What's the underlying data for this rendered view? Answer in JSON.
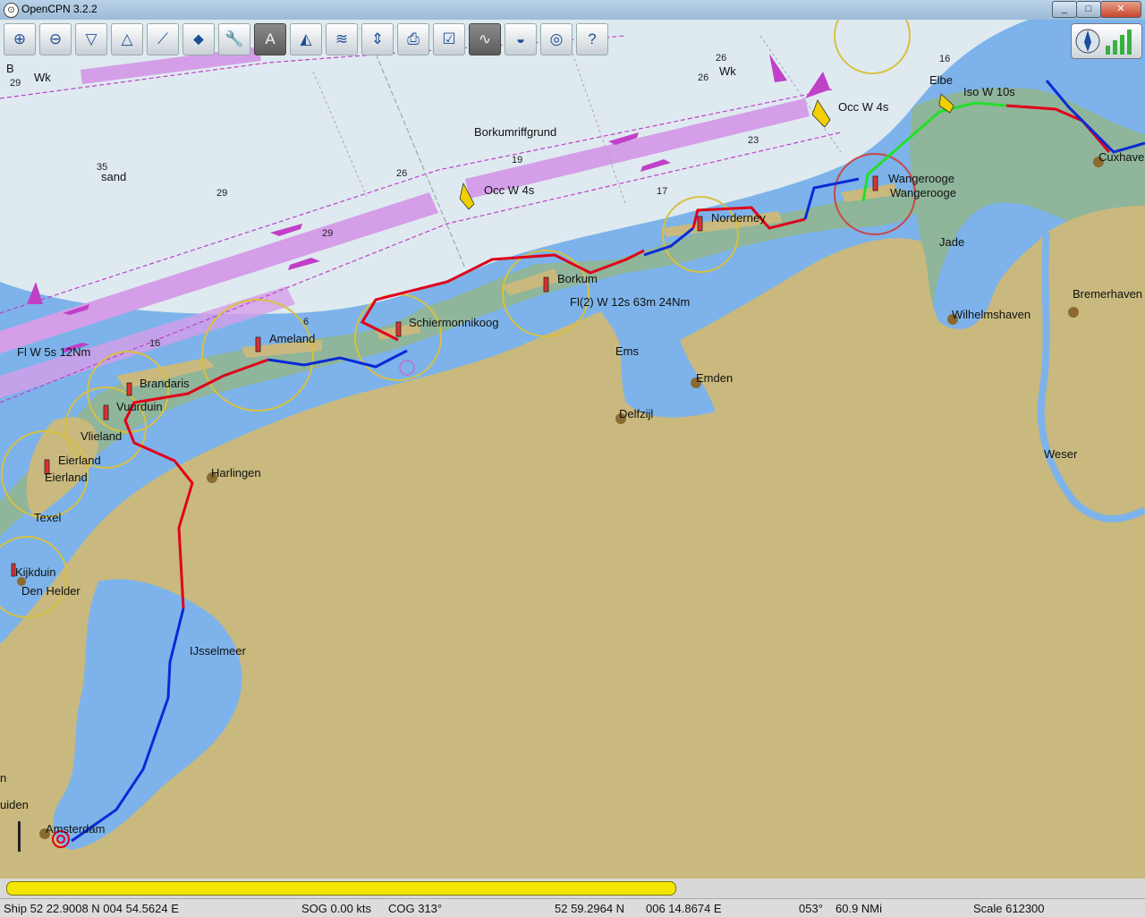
{
  "window": {
    "title": "OpenCPN 3.2.2",
    "min": "_",
    "max": "□",
    "close": "✕"
  },
  "toolbar": {
    "buttons": [
      {
        "name": "zoom-in-button",
        "icon": "zoom-in-icon",
        "glyph": "⊕"
      },
      {
        "name": "zoom-out-button",
        "icon": "zoom-out-icon",
        "glyph": "⊖"
      },
      {
        "name": "scale-in-button",
        "icon": "scale-in-icon",
        "glyph": "▽"
      },
      {
        "name": "scale-out-button",
        "icon": "scale-out-icon",
        "glyph": "△"
      },
      {
        "name": "create-route-button",
        "icon": "route-icon",
        "glyph": "⟋"
      },
      {
        "name": "auto-follow-button",
        "icon": "ship-icon",
        "glyph": "⬥"
      },
      {
        "name": "options-button",
        "icon": "wrench-icon",
        "glyph": "🔧"
      },
      {
        "name": "text-button",
        "icon": "text-icon",
        "glyph": "A"
      },
      {
        "name": "current-button",
        "icon": "current-icon",
        "glyph": "◭"
      },
      {
        "name": "tide-button",
        "icon": "tide-icon",
        "glyph": "≋"
      },
      {
        "name": "quilt-button",
        "icon": "quilt-icon",
        "glyph": "⇕"
      },
      {
        "name": "print-button",
        "icon": "printer-icon",
        "glyph": "⎙"
      },
      {
        "name": "route-manager-button",
        "icon": "route-manager-icon",
        "glyph": "☑"
      },
      {
        "name": "track-button",
        "icon": "track-icon",
        "glyph": "∿"
      },
      {
        "name": "color-scheme-button",
        "icon": "sun-icon",
        "glyph": "◒"
      },
      {
        "name": "mob-button",
        "icon": "lifebuoy-icon",
        "glyph": "◎"
      },
      {
        "name": "help-button",
        "icon": "help-icon",
        "glyph": "?"
      }
    ]
  },
  "chart": {
    "places": [
      {
        "id": "wangerooge",
        "text": "Wangerooge"
      },
      {
        "id": "wangerooge2",
        "text": "Wangerooge"
      },
      {
        "id": "norderney",
        "text": "Norderney"
      },
      {
        "id": "borkum",
        "text": "Borkum"
      },
      {
        "id": "schiermonnikoog",
        "text": "Schiermonnikoog"
      },
      {
        "id": "ameland",
        "text": "Ameland"
      },
      {
        "id": "brandaris",
        "text": "Brandaris"
      },
      {
        "id": "vuurduin",
        "text": "Vuurduin"
      },
      {
        "id": "vlieland",
        "text": "Vlieland"
      },
      {
        "id": "eierland",
        "text": "Eierland"
      },
      {
        "id": "eierland2",
        "text": "Eierland"
      },
      {
        "id": "texel",
        "text": "Texel"
      },
      {
        "id": "kijkduin",
        "text": "Kijkduin"
      },
      {
        "id": "den-helder",
        "text": "Den Helder"
      },
      {
        "id": "harlingen",
        "text": "Harlingen"
      },
      {
        "id": "ijsselmeer",
        "text": "IJsselmeer"
      },
      {
        "id": "amsterdam",
        "text": "Amsterdam"
      },
      {
        "id": "ijmuiden",
        "text": "uiden"
      },
      {
        "id": "ems",
        "text": "Ems"
      },
      {
        "id": "emden",
        "text": "Emden"
      },
      {
        "id": "delfzijl",
        "text": "Delfzijl"
      },
      {
        "id": "jade",
        "text": "Jade"
      },
      {
        "id": "wilhelmshaven",
        "text": "Wilhelmshaven"
      },
      {
        "id": "bremerhaven",
        "text": "Bremerhaven"
      },
      {
        "id": "weser",
        "text": "Weser"
      },
      {
        "id": "cuxhaven",
        "text": "Cuxhaven"
      },
      {
        "id": "elbe",
        "text": "Elbe"
      },
      {
        "id": "borkumriffgrund",
        "text": "Borkumriffgrund"
      },
      {
        "id": "sand",
        "text": "sand"
      },
      {
        "id": "wk1",
        "text": "Wk"
      },
      {
        "id": "wk2",
        "text": "Wk"
      },
      {
        "id": "b",
        "text": "B"
      },
      {
        "id": "n",
        "text": "n"
      }
    ],
    "lights": [
      {
        "id": "occ1",
        "text": "Occ W 4s"
      },
      {
        "id": "occ2",
        "text": "Occ W 4s"
      },
      {
        "id": "iso",
        "text": "Iso W 10s"
      },
      {
        "id": "fl2",
        "text": "Fl(2) W 12s 63m 24Nm"
      },
      {
        "id": "fl5",
        "text": "Fl W 5s 12Nm"
      }
    ],
    "depths": [
      {
        "id": "d35",
        "text": "35"
      },
      {
        "id": "d29a",
        "text": "29"
      },
      {
        "id": "d29b",
        "text": "29"
      },
      {
        "id": "d26a",
        "text": "26"
      },
      {
        "id": "d26b",
        "text": "26"
      },
      {
        "id": "d26c",
        "text": "26"
      },
      {
        "id": "d23",
        "text": "23"
      },
      {
        "id": "d19",
        "text": "19"
      },
      {
        "id": "d17",
        "text": "17"
      },
      {
        "id": "d16a",
        "text": "16"
      },
      {
        "id": "d16b",
        "text": "16"
      },
      {
        "id": "d29c",
        "text": "29"
      },
      {
        "id": "d6",
        "text": "6"
      }
    ],
    "colors": {
      "land": "#c9b97e",
      "shallow": "#7db3ea",
      "sea": "#deeaf0",
      "tidal": "#8fb59a",
      "route_red": "#e0001a",
      "route_blue": "#0a2ad6",
      "route_green": "#22e02a",
      "tss": "#d59ee8"
    }
  },
  "progress": {
    "value": 0.59
  },
  "statusbar": {
    "ship": "Ship 52 22.9008 N   004 54.5624 E",
    "sog": "SOG 0.00 kts",
    "cog": "COG 313°",
    "cursor_lat": "52 59.2964 N",
    "cursor_lon": "006 14.8674 E",
    "bearing": "053°",
    "distance": "60.9 NMi",
    "scale": "Scale 612300"
  }
}
